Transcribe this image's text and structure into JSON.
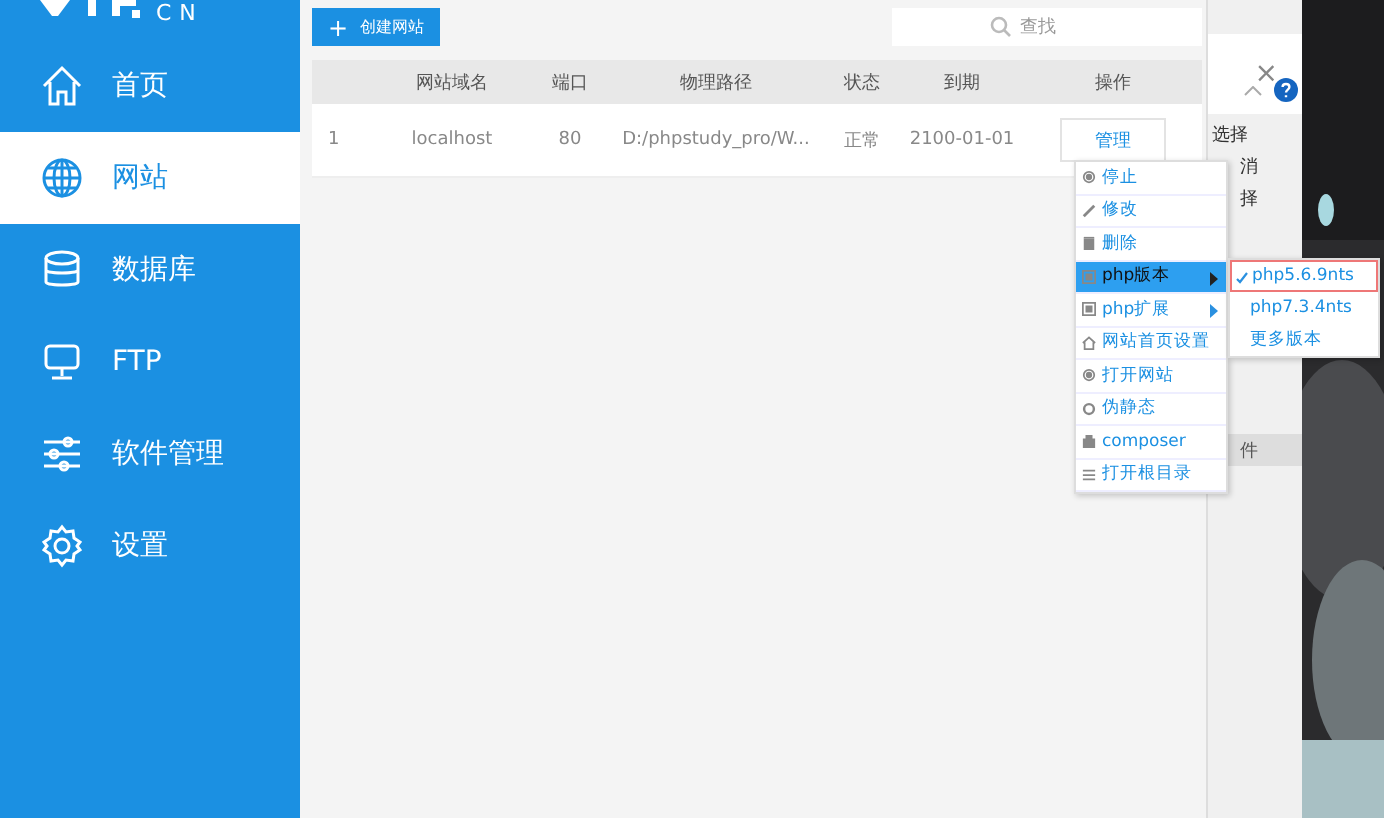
{
  "logo": {
    "text": "CN"
  },
  "sidebar": {
    "items": [
      {
        "label": "首页",
        "selected": false
      },
      {
        "label": "网站",
        "selected": true
      },
      {
        "label": "数据库",
        "selected": false
      },
      {
        "label": "FTP",
        "selected": false
      },
      {
        "label": "软件管理",
        "selected": false
      },
      {
        "label": "设置",
        "selected": false
      }
    ]
  },
  "toolbar": {
    "create_button": "创建网站",
    "create_icon": "+",
    "search": {
      "placeholder": "查找"
    }
  },
  "table": {
    "columns": [
      "",
      "网站域名",
      "端口",
      "物理路径",
      "状态",
      "到期",
      "操作"
    ],
    "rows": [
      {
        "cells": [
          "1",
          "localhost",
          "80",
          "D:/phpstudy_pro/W...",
          "正常",
          "2100-01-01"
        ],
        "action": "管理"
      }
    ]
  },
  "context_menu": {
    "items": [
      {
        "label": "停止",
        "selected": false,
        "submenu": false
      },
      {
        "label": "修改",
        "selected": false,
        "submenu": false
      },
      {
        "label": "删除",
        "selected": false,
        "submenu": false
      },
      {
        "label": "php版本",
        "selected": true,
        "submenu": true
      },
      {
        "label": "php扩展",
        "selected": false,
        "submenu": true
      },
      {
        "label": "网站首页设置",
        "selected": false,
        "submenu": false
      },
      {
        "label": "打开网站",
        "selected": false,
        "submenu": false
      },
      {
        "label": "伪静态",
        "selected": false,
        "submenu": false
      },
      {
        "label": "composer",
        "selected": false,
        "submenu": false
      },
      {
        "label": "打开根目录",
        "selected": false,
        "submenu": false
      }
    ]
  },
  "submenu": {
    "items": [
      {
        "label": "php5.6.9nts",
        "checked": true
      },
      {
        "label": "php7.3.4nts",
        "checked": false
      },
      {
        "label": "更多版本",
        "checked": false
      }
    ]
  },
  "back_dialog": {
    "close": "×",
    "texts": [
      "选择",
      "消",
      "择"
    ],
    "footer": "件"
  }
}
